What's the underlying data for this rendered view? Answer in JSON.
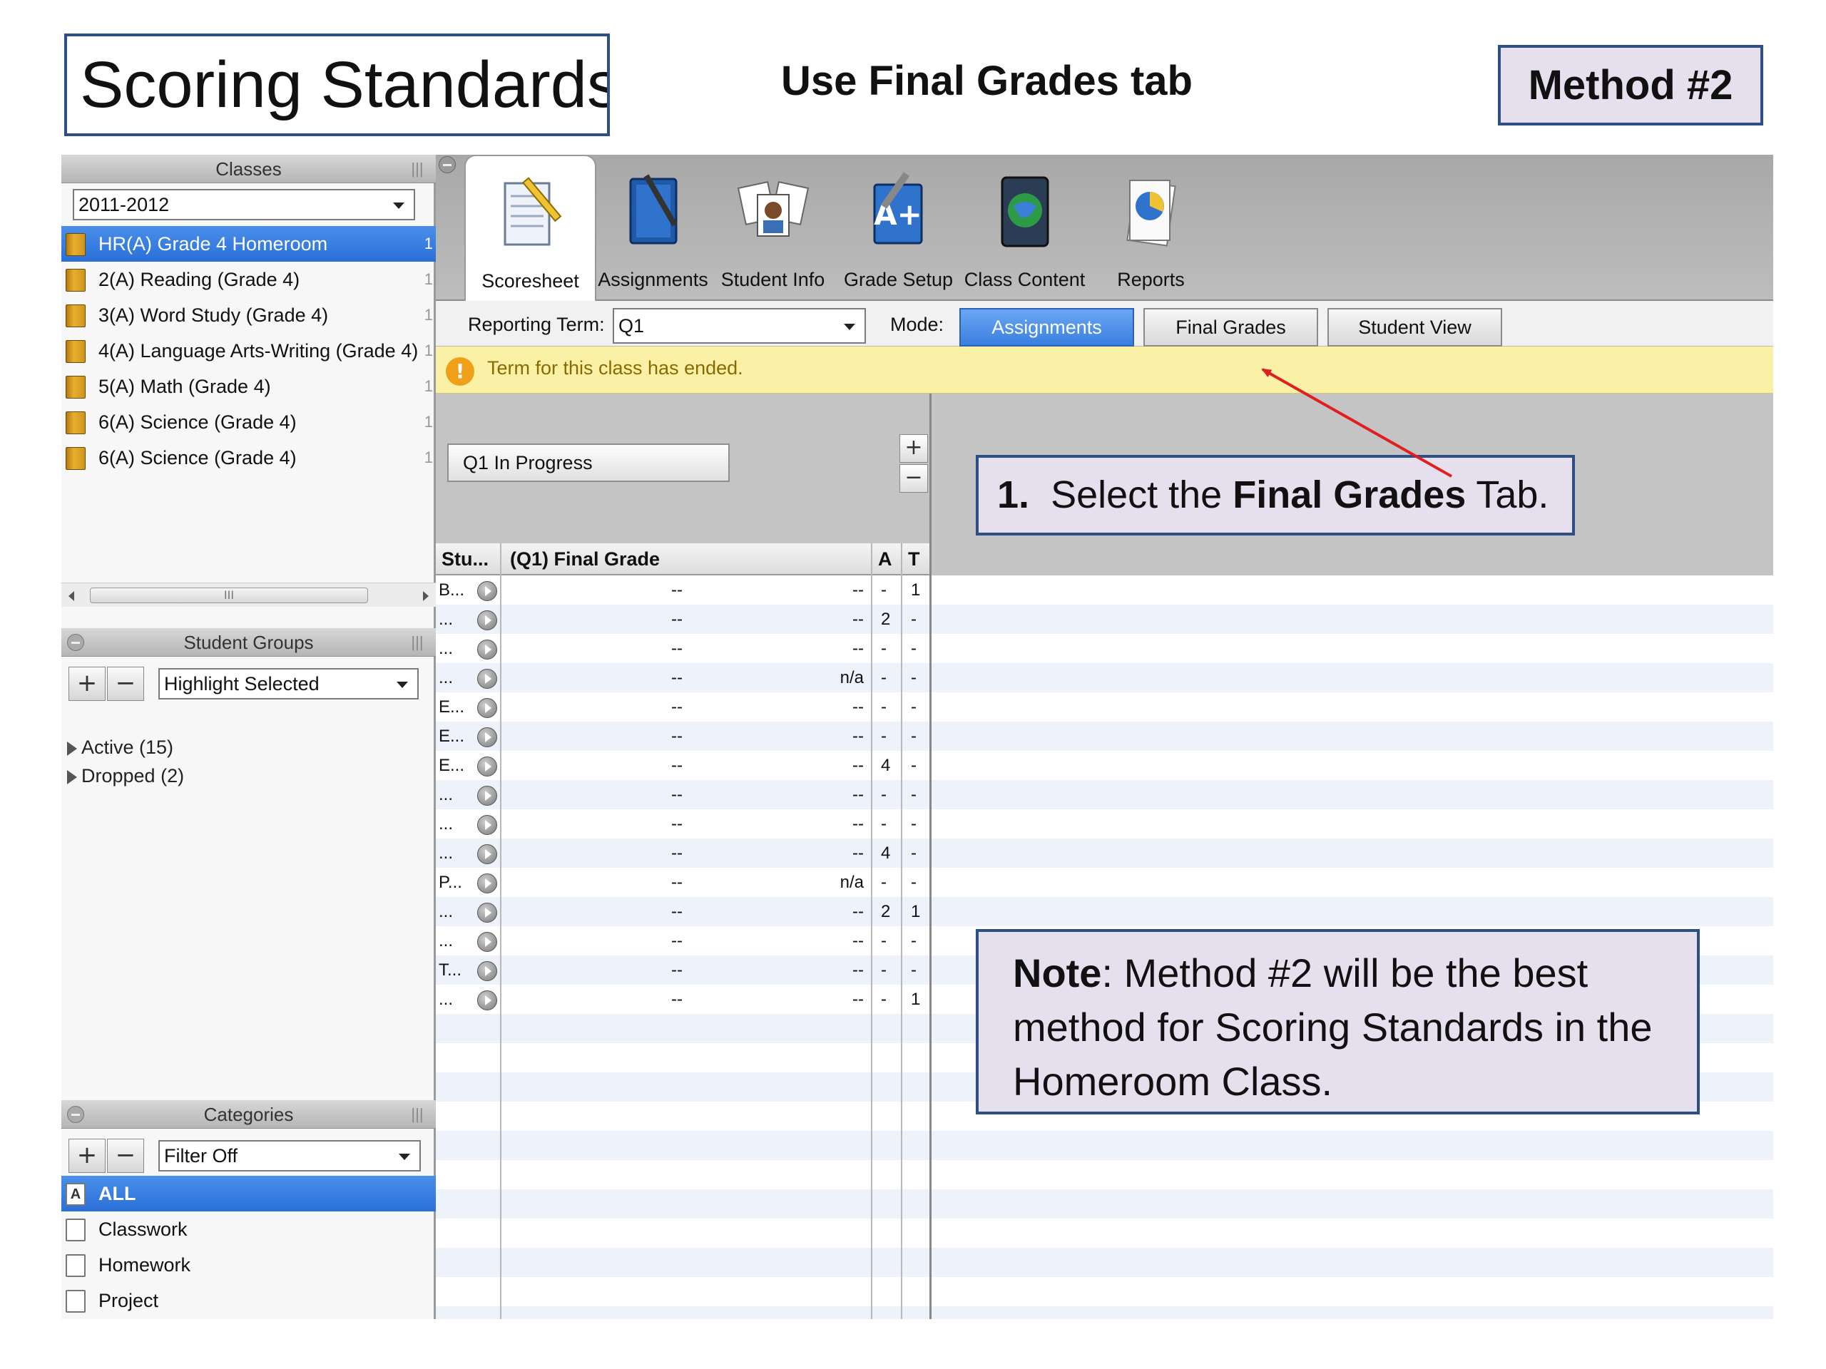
{
  "slide": {
    "title": "Scoring Standards",
    "subtitle": "Use Final Grades tab",
    "method": "Method #2"
  },
  "classes_panel": {
    "header": "Classes",
    "year_select": "2011-2012",
    "items": [
      {
        "label": "HR(A) Grade 4 Homeroom",
        "count": "1",
        "selected": true
      },
      {
        "label": "2(A) Reading (Grade 4)",
        "count": "1"
      },
      {
        "label": "3(A) Word Study (Grade 4)",
        "count": "1"
      },
      {
        "label": "4(A) Language Arts-Writing (Grade 4)",
        "count": "1"
      },
      {
        "label": "5(A) Math (Grade 4)",
        "count": "1"
      },
      {
        "label": "6(A) Science (Grade 4)",
        "count": "1"
      },
      {
        "label": "6(A) Science (Grade 4)",
        "count": "1"
      }
    ]
  },
  "student_groups": {
    "header": "Student Groups",
    "select": "Highlight Selected",
    "items": [
      "Active (15)",
      "Dropped (2)"
    ]
  },
  "categories": {
    "header": "Categories",
    "select": "Filter Off",
    "items": [
      {
        "label": "ALL",
        "icon_letter": "A",
        "selected": true
      },
      {
        "label": "Classwork",
        "icon_letter": ""
      },
      {
        "label": "Homework",
        "icon_letter": ""
      },
      {
        "label": "Project",
        "icon_letter": ""
      }
    ]
  },
  "toolbar": {
    "tabs": [
      {
        "label": "Scoresheet",
        "icon": "scoresheet-icon",
        "active": true
      },
      {
        "label": "Assignments",
        "icon": "assignments-icon"
      },
      {
        "label": "Student Info",
        "icon": "student-info-icon"
      },
      {
        "label": "Grade Setup",
        "icon": "grade-setup-icon"
      },
      {
        "label": "Class Content",
        "icon": "class-content-icon"
      },
      {
        "label": "Reports",
        "icon": "reports-icon"
      }
    ]
  },
  "term_bar": {
    "reporting_term_label": "Reporting Term:",
    "reporting_term_value": "Q1",
    "mode_label": "Mode:",
    "modes": [
      {
        "label": "Assignments",
        "active": true
      },
      {
        "label": "Final Grades"
      },
      {
        "label": "Student View"
      }
    ]
  },
  "warning": "Term for this class has ended.",
  "grade_panel": {
    "progress_label": "Q1 In Progress",
    "plus": "+",
    "minus": "−",
    "columns": {
      "student": "Stu...",
      "final": "(Q1) Final Grade",
      "a": "A",
      "t": "T"
    },
    "rows": [
      {
        "s": "B...",
        "g1": "--",
        "g2": "--",
        "a": "-",
        "t": "1"
      },
      {
        "s": "...",
        "g1": "--",
        "g2": "--",
        "a": "2",
        "t": "-"
      },
      {
        "s": "...",
        "g1": "--",
        "g2": "--",
        "a": "-",
        "t": "-"
      },
      {
        "s": "...",
        "g1": "--",
        "g2": "n/a",
        "a": "-",
        "t": "-"
      },
      {
        "s": "E...",
        "g1": "--",
        "g2": "--",
        "a": "-",
        "t": "-"
      },
      {
        "s": "E...",
        "g1": "--",
        "g2": "--",
        "a": "-",
        "t": "-"
      },
      {
        "s": "E...",
        "g1": "--",
        "g2": "--",
        "a": "4",
        "t": "-"
      },
      {
        "s": "...",
        "g1": "--",
        "g2": "--",
        "a": "-",
        "t": "-"
      },
      {
        "s": "...",
        "g1": "--",
        "g2": "--",
        "a": "-",
        "t": "-"
      },
      {
        "s": "...",
        "g1": "--",
        "g2": "--",
        "a": "4",
        "t": "-"
      },
      {
        "s": "P...",
        "g1": "--",
        "g2": "n/a",
        "a": "-",
        "t": "-"
      },
      {
        "s": "...",
        "g1": "--",
        "g2": "--",
        "a": "2",
        "t": "1"
      },
      {
        "s": "...",
        "g1": "--",
        "g2": "--",
        "a": "-",
        "t": "-"
      },
      {
        "s": "T...",
        "g1": "--",
        "g2": "--",
        "a": "-",
        "t": "-"
      },
      {
        "s": "...",
        "g1": "--",
        "g2": "--",
        "a": "-",
        "t": "1"
      }
    ]
  },
  "callout1": {
    "num": "1.",
    "pre": "Select the ",
    "bold": "Final Grades",
    "post": " Tab."
  },
  "callout2": {
    "bold": "Note",
    "text": ":  Method #2 will be the best method for Scoring Standards in the Homeroom Class."
  },
  "colors": {
    "accent_blue": "#2e4f86",
    "selection_blue": "#3a7fe0",
    "warning_yellow": "#fbf1a6",
    "arrow_red": "#e02020"
  }
}
